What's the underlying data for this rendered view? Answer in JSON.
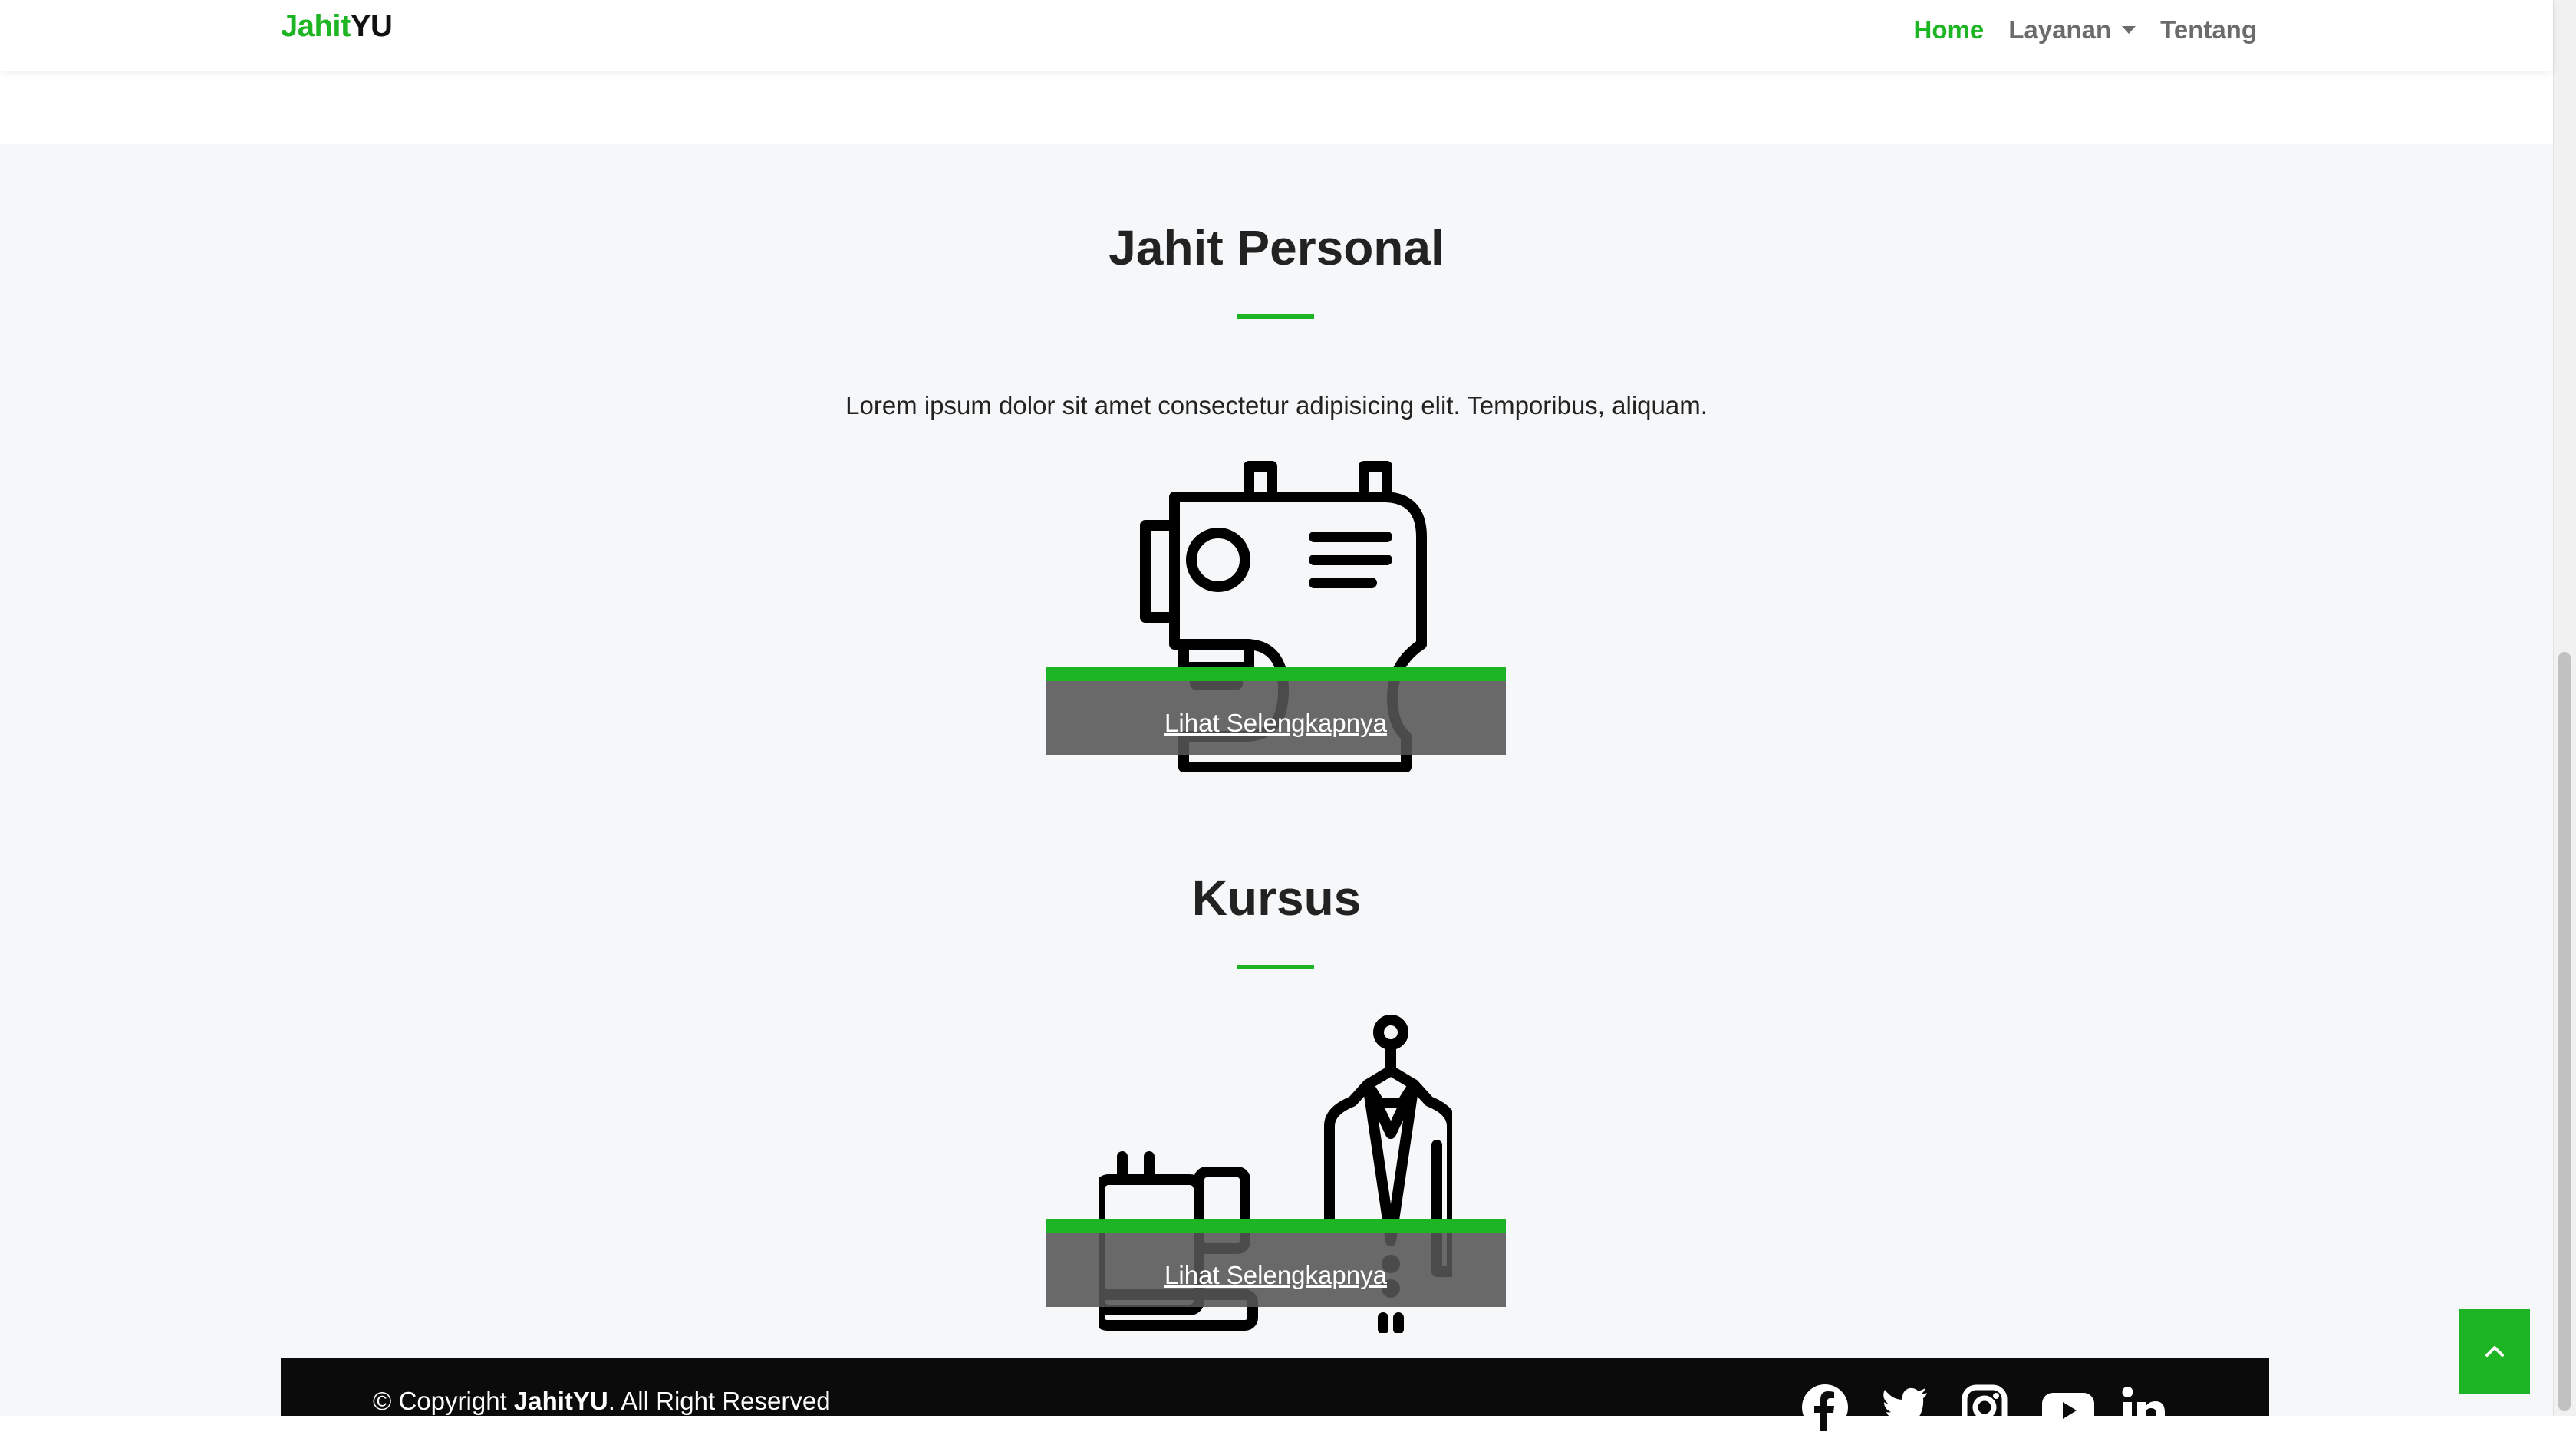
{
  "navbar": {
    "brand_part1": "Jahit",
    "brand_part2": "YU",
    "links": [
      {
        "label": "Home",
        "active": true
      },
      {
        "label": "Layanan",
        "dropdown": true
      },
      {
        "label": "Tentang"
      }
    ]
  },
  "services": {
    "personal": {
      "title": "Jahit Personal",
      "description": "Lorem ipsum dolor sit amet consectetur adipisicing elit. Temporibus, aliquam.",
      "link_label": "Lihat Selengkapnya",
      "icon": "sewing-machine-icon"
    },
    "course": {
      "title": "Kursus",
      "link_label": "Lihat Selengkapnya",
      "icon": "tailor-mannequin-icon"
    }
  },
  "footer": {
    "copyright_prefix": "© Copyright ",
    "copyright_brand": "JahitYU",
    "copyright_suffix": ". All Right Reserved",
    "social_icons": [
      "facebook-icon",
      "twitter-icon",
      "instagram-icon",
      "youtube-icon",
      "linkedin-icon"
    ]
  },
  "back_to_top": {
    "icon": "chevron-up-icon"
  },
  "colors": {
    "accent": "#1db524",
    "footer_bg": "#0b0b0b",
    "section_bg": "#f6f7f8"
  }
}
